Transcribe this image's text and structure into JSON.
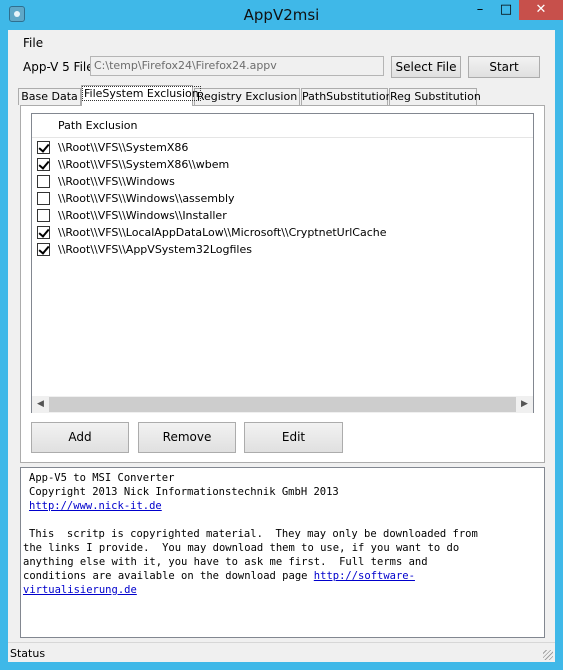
{
  "window": {
    "title": "AppV2msi",
    "minimize_glyph": "–",
    "maximize_glyph": "□",
    "close_glyph": "✕"
  },
  "menu": {
    "file": "File"
  },
  "form": {
    "appv_label": "App-V 5 File",
    "appv_path": "C:\\temp\\Firefox24\\Firefox24.appv",
    "select_file": "Select File",
    "start": "Start"
  },
  "tabs": [
    {
      "label": "Base Data",
      "active": false
    },
    {
      "label": "FileSystem Exclusion",
      "active": true
    },
    {
      "label": "Registry Exclusion",
      "active": false
    },
    {
      "label": "PathSubstitution",
      "active": false
    },
    {
      "label": "Reg Substitution",
      "active": false
    }
  ],
  "exclusions": {
    "column_header": "Path Exclusion",
    "rows": [
      {
        "path": "\\\\Root\\\\VFS\\\\SystemX86",
        "checked": true
      },
      {
        "path": "\\\\Root\\\\VFS\\\\SystemX86\\\\wbem",
        "checked": true
      },
      {
        "path": "\\\\Root\\\\VFS\\\\Windows",
        "checked": false
      },
      {
        "path": "\\\\Root\\\\VFS\\\\Windows\\\\assembly",
        "checked": false
      },
      {
        "path": "\\\\Root\\\\VFS\\\\Windows\\\\Installer",
        "checked": false
      },
      {
        "path": "\\\\Root\\\\VFS\\\\LocalAppDataLow\\\\Microsoft\\\\CryptnetUrlCache",
        "checked": true
      },
      {
        "path": "\\\\Root\\\\VFS\\\\AppVSystem32Logfiles",
        "checked": true
      }
    ],
    "add": "Add",
    "remove": "Remove",
    "edit": "Edit"
  },
  "info": {
    "line1": "App-V5 to MSI Converter",
    "line2": "Copyright 2013 Nick Informationstechnik GmbH 2013",
    "link1": "http://www.nick-it.de",
    "p1": "This  scritp is copyrighted material.  They may only be downloaded from",
    "p2": "the links I provide.  You may download them to use, if you want to do",
    "p3": "anything else with it, you have to ask me first.  Full terms and",
    "p4": "conditions are available on the download page ",
    "link2a": "http://software-",
    "link2b": "virtualisierung.de"
  },
  "status": {
    "text": "Status"
  },
  "colors": {
    "titlebar": "#3fb8e8",
    "close": "#c7504b",
    "link": "#0000cc"
  }
}
